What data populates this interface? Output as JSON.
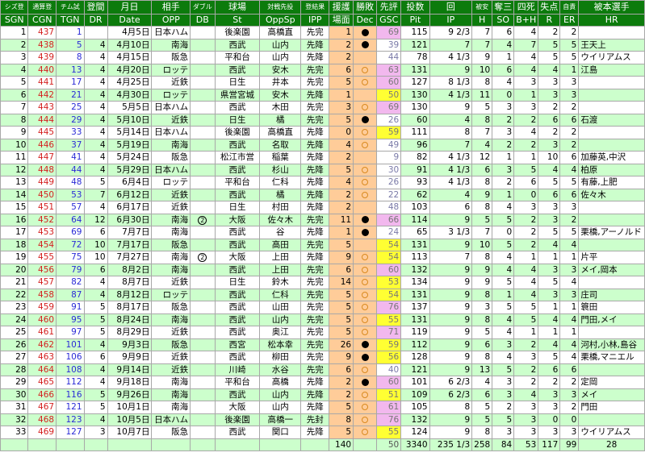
{
  "header_jp": [
    "シズ登",
    "通算登",
    "チム試",
    "登間",
    "月日",
    "相手",
    "ダブル",
    "球場",
    "対戦先投",
    "登結果",
    "援護",
    "勝敗",
    "先評",
    "投数",
    "回",
    "被安",
    "奪三",
    "四死",
    "失点",
    "自責",
    "被本選手"
  ],
  "header_en": [
    "SGN",
    "CGN",
    "TGN",
    "DR",
    "Date",
    "OPP",
    "DB",
    "St",
    "OppSp",
    "IPP",
    "場面",
    "Dec",
    "GSC",
    "Pit",
    "IP",
    "H",
    "SO",
    "B+H",
    "R",
    "ER",
    "HR"
  ],
  "rows": [
    {
      "sgn": "1",
      "cgn": "437",
      "tgn": "1",
      "dr": "",
      "date": "4月5日",
      "opp": "日本ハム",
      "db": "",
      "st": "後楽園",
      "oppsp": "高橋直",
      "ipp": "先完",
      "sc": "1",
      "dec": "W",
      "gsc": "69",
      "pit": "115",
      "ip": "9 2/3",
      "h": "7",
      "so": "6",
      "bh": "4",
      "r": "2",
      "er": "2",
      "hr": ""
    },
    {
      "sgn": "2",
      "cgn": "438",
      "tgn": "5",
      "dr": "4",
      "date": "4月10日",
      "opp": "南海",
      "db": "",
      "st": "西武",
      "oppsp": "山内",
      "ipp": "先降",
      "sc": "2",
      "dec": "W",
      "gsc": "39",
      "pit": "121",
      "ip": "7",
      "h": "7",
      "so": "4",
      "bh": "7",
      "r": "5",
      "er": "5",
      "hr": "王天上"
    },
    {
      "sgn": "3",
      "cgn": "439",
      "tgn": "8",
      "dr": "4",
      "date": "4月15日",
      "opp": "阪急",
      "db": "",
      "st": "平和台",
      "oppsp": "山内",
      "ipp": "先降",
      "sc": "2",
      "dec": "",
      "gsc": "44",
      "pit": "78",
      "ip": "4 1/3",
      "h": "9",
      "so": "1",
      "bh": "4",
      "r": "5",
      "er": "5",
      "hr": "ウイリアムス"
    },
    {
      "sgn": "4",
      "cgn": "440",
      "tgn": "13",
      "dr": "4",
      "date": "4月20日",
      "opp": "ロッテ",
      "db": "",
      "st": "西武",
      "oppsp": "安木",
      "ipp": "先完",
      "sc": "6",
      "dec": "L",
      "gsc": "63",
      "pit": "131",
      "ip": "9",
      "h": "10",
      "so": "6",
      "bh": "4",
      "r": "4",
      "er": "1",
      "hr": "江島"
    },
    {
      "sgn": "5",
      "cgn": "441",
      "tgn": "17",
      "dr": "4",
      "date": "4月25日",
      "opp": "近鉄",
      "db": "",
      "st": "日生",
      "oppsp": "井本",
      "ipp": "先完",
      "sc": "5",
      "dec": "L",
      "gsc": "60",
      "pit": "127",
      "ip": "8 1/3",
      "h": "8",
      "so": "4",
      "bh": "3",
      "r": "3",
      "er": "3",
      "hr": ""
    },
    {
      "sgn": "6",
      "cgn": "442",
      "tgn": "21",
      "dr": "4",
      "date": "4月30日",
      "opp": "ロッテ",
      "db": "",
      "st": "県営宮城",
      "oppsp": "安木",
      "ipp": "先降",
      "sc": "1",
      "dec": "",
      "gsc": "50",
      "pit": "130",
      "ip": "4 1/3",
      "h": "11",
      "so": "0",
      "bh": "1",
      "r": "3",
      "er": "3",
      "hr": ""
    },
    {
      "sgn": "7",
      "cgn": "443",
      "tgn": "25",
      "dr": "4",
      "date": "5月5日",
      "opp": "日本ハム",
      "db": "",
      "st": "西武",
      "oppsp": "木田",
      "ipp": "先完",
      "sc": "3",
      "dec": "L",
      "gsc": "69",
      "pit": "130",
      "ip": "9",
      "h": "5",
      "so": "3",
      "bh": "3",
      "r": "2",
      "er": "2",
      "hr": ""
    },
    {
      "sgn": "8",
      "cgn": "444",
      "tgn": "29",
      "dr": "4",
      "date": "5月10日",
      "opp": "近鉄",
      "db": "",
      "st": "日生",
      "oppsp": "橘",
      "ipp": "先完",
      "sc": "5",
      "dec": "W",
      "gsc": "26",
      "pit": "60",
      "ip": "4",
      "h": "8",
      "so": "2",
      "bh": "2",
      "r": "6",
      "er": "6",
      "hr": "石渡"
    },
    {
      "sgn": "9",
      "cgn": "445",
      "tgn": "33",
      "dr": "4",
      "date": "5月14日",
      "opp": "日本ハム",
      "db": "",
      "st": "後楽園",
      "oppsp": "高橋直",
      "ipp": "先降",
      "sc": "0",
      "dec": "L",
      "gsc": "59",
      "pit": "111",
      "ip": "8",
      "h": "7",
      "so": "3",
      "bh": "4",
      "r": "2",
      "er": "2",
      "hr": ""
    },
    {
      "sgn": "10",
      "cgn": "446",
      "tgn": "37",
      "dr": "4",
      "date": "5月19日",
      "opp": "南海",
      "db": "",
      "st": "西武",
      "oppsp": "名取",
      "ipp": "先降",
      "sc": "4",
      "dec": "L",
      "gsc": "49",
      "pit": "96",
      "ip": "7",
      "h": "4",
      "so": "2",
      "bh": "2",
      "r": "3",
      "er": "2",
      "hr": ""
    },
    {
      "sgn": "11",
      "cgn": "447",
      "tgn": "41",
      "dr": "4",
      "date": "5月24日",
      "opp": "阪急",
      "db": "",
      "st": "松江市営",
      "oppsp": "稲葉",
      "ipp": "先降",
      "sc": "2",
      "dec": "",
      "gsc": "9",
      "pit": "82",
      "ip": "4 1/3",
      "h": "12",
      "so": "1",
      "bh": "1",
      "r": "10",
      "er": "6",
      "hr": "加藤英,中沢"
    },
    {
      "sgn": "12",
      "cgn": "448",
      "tgn": "44",
      "dr": "4",
      "date": "5月29日",
      "opp": "日本ハム",
      "db": "",
      "st": "西武",
      "oppsp": "杉山",
      "ipp": "先降",
      "sc": "5",
      "dec": "L",
      "gsc": "30",
      "pit": "91",
      "ip": "4 1/3",
      "h": "6",
      "so": "3",
      "bh": "5",
      "r": "4",
      "er": "4",
      "hr": "柏原"
    },
    {
      "sgn": "13",
      "cgn": "449",
      "tgn": "48",
      "dr": "5",
      "date": "6月4日",
      "opp": "ロッテ",
      "db": "",
      "st": "平和台",
      "oppsp": "仁科",
      "ipp": "先降",
      "sc": "4",
      "dec": "L",
      "gsc": "26",
      "pit": "93",
      "ip": "4 1/3",
      "h": "8",
      "so": "2",
      "bh": "6",
      "r": "5",
      "er": "5",
      "hr": "有藤,上肥"
    },
    {
      "sgn": "14",
      "cgn": "450",
      "tgn": "53",
      "dr": "7",
      "date": "6月12日",
      "opp": "近鉄",
      "db": "",
      "st": "西武",
      "oppsp": "橘",
      "ipp": "先降",
      "sc": "2",
      "dec": "L",
      "gsc": "22",
      "pit": "62",
      "ip": "4",
      "h": "9",
      "so": "1",
      "bh": "0",
      "r": "6",
      "er": "6",
      "hr": "佐々木"
    },
    {
      "sgn": "15",
      "cgn": "451",
      "tgn": "57",
      "dr": "4",
      "date": "6月17日",
      "opp": "近鉄",
      "db": "",
      "st": "日生",
      "oppsp": "村田",
      "ipp": "先降",
      "sc": "2",
      "dec": "",
      "gsc": "48",
      "pit": "103",
      "ip": "6",
      "h": "8",
      "so": "4",
      "bh": "3",
      "r": "3",
      "er": "3",
      "hr": ""
    },
    {
      "sgn": "16",
      "cgn": "452",
      "tgn": "64",
      "dr": "12",
      "date": "6月30日",
      "opp": "南海",
      "db": "②",
      "st": "大阪",
      "oppsp": "佐々木",
      "ipp": "先完",
      "sc": "11",
      "dec": "W",
      "gsc": "66",
      "pit": "114",
      "ip": "9",
      "h": "5",
      "so": "5",
      "bh": "2",
      "r": "3",
      "er": "2",
      "hr": ""
    },
    {
      "sgn": "17",
      "cgn": "453",
      "tgn": "69",
      "dr": "6",
      "date": "7月7日",
      "opp": "南海",
      "db": "",
      "st": "西武",
      "oppsp": "谷",
      "ipp": "先降",
      "sc": "1",
      "dec": "W",
      "gsc": "24",
      "pit": "65",
      "ip": "3 1/3",
      "h": "7",
      "so": "0",
      "bh": "2",
      "r": "5",
      "er": "5",
      "hr": "栗橋,アーノルド"
    },
    {
      "sgn": "18",
      "cgn": "454",
      "tgn": "72",
      "dr": "10",
      "date": "7月17日",
      "opp": "阪急",
      "db": "",
      "st": "西武",
      "oppsp": "高田",
      "ipp": "先完",
      "sc": "5",
      "dec": "",
      "gsc": "54",
      "pit": "131",
      "ip": "9",
      "h": "10",
      "so": "5",
      "bh": "2",
      "r": "4",
      "er": "4",
      "hr": ""
    },
    {
      "sgn": "19",
      "cgn": "455",
      "tgn": "75",
      "dr": "10",
      "date": "7月27日",
      "opp": "南海",
      "db": "②",
      "st": "大阪",
      "oppsp": "上田",
      "ipp": "先降",
      "sc": "9",
      "dec": "L",
      "gsc": "54",
      "pit": "113",
      "ip": "7",
      "h": "8",
      "so": "4",
      "bh": "1",
      "r": "1",
      "er": "1",
      "hr": "片平"
    },
    {
      "sgn": "20",
      "cgn": "456",
      "tgn": "79",
      "dr": "6",
      "date": "8月2日",
      "opp": "南海",
      "db": "",
      "st": "西武",
      "oppsp": "上田",
      "ipp": "先完",
      "sc": "6",
      "dec": "L",
      "gsc": "60",
      "pit": "132",
      "ip": "9",
      "h": "9",
      "so": "4",
      "bh": "4",
      "r": "3",
      "er": "3",
      "hr": "メイ,岡本"
    },
    {
      "sgn": "21",
      "cgn": "457",
      "tgn": "82",
      "dr": "4",
      "date": "8月7日",
      "opp": "近鉄",
      "db": "",
      "st": "日生",
      "oppsp": "鈴木",
      "ipp": "先完",
      "sc": "14",
      "dec": "L",
      "gsc": "53",
      "pit": "134",
      "ip": "9",
      "h": "9",
      "so": "5",
      "bh": "4",
      "r": "5",
      "er": "4",
      "hr": ""
    },
    {
      "sgn": "22",
      "cgn": "458",
      "tgn": "87",
      "dr": "4",
      "date": "8月12日",
      "opp": "ロッテ",
      "db": "",
      "st": "西武",
      "oppsp": "仁科",
      "ipp": "先完",
      "sc": "5",
      "dec": "L",
      "gsc": "54",
      "pit": "131",
      "ip": "9",
      "h": "8",
      "so": "1",
      "bh": "4",
      "r": "3",
      "er": "3",
      "hr": "庄司"
    },
    {
      "sgn": "23",
      "cgn": "459",
      "tgn": "91",
      "dr": "5",
      "date": "8月17日",
      "opp": "阪急",
      "db": "",
      "st": "西武",
      "oppsp": "山田",
      "ipp": "先完",
      "sc": "5",
      "dec": "L",
      "gsc": "76",
      "pit": "137",
      "ip": "9",
      "h": "3",
      "so": "5",
      "bh": "5",
      "r": "1",
      "er": "1",
      "hr": "簑田"
    },
    {
      "sgn": "24",
      "cgn": "460",
      "tgn": "95",
      "dr": "5",
      "date": "8月24日",
      "opp": "南海",
      "db": "",
      "st": "西武",
      "oppsp": "山内",
      "ipp": "先完",
      "sc": "5",
      "dec": "L",
      "gsc": "55",
      "pit": "131",
      "ip": "9",
      "h": "8",
      "so": "4",
      "bh": "5",
      "r": "4",
      "er": "4",
      "hr": "門田,メイ"
    },
    {
      "sgn": "25",
      "cgn": "461",
      "tgn": "97",
      "dr": "5",
      "date": "8月29日",
      "opp": "近鉄",
      "db": "",
      "st": "西武",
      "oppsp": "奥江",
      "ipp": "先完",
      "sc": "5",
      "dec": "L",
      "gsc": "71",
      "pit": "119",
      "ip": "9",
      "h": "5",
      "so": "4",
      "bh": "1",
      "r": "1",
      "er": "1",
      "hr": ""
    },
    {
      "sgn": "26",
      "cgn": "462",
      "tgn": "101",
      "dr": "4",
      "date": "9月3日",
      "opp": "阪急",
      "db": "",
      "st": "西宮",
      "oppsp": "松本幸",
      "ipp": "先完",
      "sc": "26",
      "dec": "W",
      "gsc": "59",
      "pit": "112",
      "ip": "9",
      "h": "6",
      "so": "3",
      "bh": "2",
      "r": "4",
      "er": "4",
      "hr": "河村,小林,島谷"
    },
    {
      "sgn": "27",
      "cgn": "463",
      "tgn": "106",
      "dr": "6",
      "date": "9月9日",
      "opp": "近鉄",
      "db": "",
      "st": "西武",
      "oppsp": "柳田",
      "ipp": "先完",
      "sc": "9",
      "dec": "W",
      "gsc": "56",
      "pit": "128",
      "ip": "9",
      "h": "8",
      "so": "4",
      "bh": "3",
      "r": "5",
      "er": "4",
      "hr": "栗橋,マニエル"
    },
    {
      "sgn": "28",
      "cgn": "464",
      "tgn": "108",
      "dr": "4",
      "date": "9月14日",
      "opp": "近鉄",
      "db": "",
      "st": "川崎",
      "oppsp": "水谷",
      "ipp": "先完",
      "sc": "6",
      "dec": "L",
      "gsc": "40",
      "pit": "121",
      "ip": "9",
      "h": "13",
      "so": "5",
      "bh": "2",
      "r": "6",
      "er": "6",
      "hr": ""
    },
    {
      "sgn": "29",
      "cgn": "465",
      "tgn": "112",
      "dr": "4",
      "date": "9月18日",
      "opp": "南海",
      "db": "",
      "st": "平和台",
      "oppsp": "高橋",
      "ipp": "先降",
      "sc": "2",
      "dec": "W",
      "gsc": "60",
      "pit": "101",
      "ip": "6 2/3",
      "h": "4",
      "so": "3",
      "bh": "2",
      "r": "2",
      "er": "2",
      "hr": "定岡"
    },
    {
      "sgn": "30",
      "cgn": "466",
      "tgn": "116",
      "dr": "5",
      "date": "9月26日",
      "opp": "南海",
      "db": "",
      "st": "西武",
      "oppsp": "山内",
      "ipp": "先降",
      "sc": "2",
      "dec": "L",
      "gsc": "51",
      "pit": "109",
      "ip": "6 2/3",
      "h": "6",
      "so": "3",
      "bh": "4",
      "r": "3",
      "er": "3",
      "hr": "メイ"
    },
    {
      "sgn": "31",
      "cgn": "467",
      "tgn": "121",
      "dr": "5",
      "date": "10月1日",
      "opp": "南海",
      "db": "",
      "st": "大阪",
      "oppsp": "山内",
      "ipp": "先降",
      "sc": "5",
      "dec": "L",
      "gsc": "61",
      "pit": "105",
      "ip": "8",
      "h": "5",
      "so": "2",
      "bh": "3",
      "r": "3",
      "er": "2",
      "hr": "門田"
    },
    {
      "sgn": "32",
      "cgn": "468",
      "tgn": "123",
      "dr": "4",
      "date": "10月5日",
      "opp": "日本ハム",
      "db": "",
      "st": "後楽園",
      "oppsp": "高橋一",
      "ipp": "先封",
      "sc": "8",
      "dec": "L",
      "gsc": "76",
      "pit": "132",
      "ip": "9",
      "h": "5",
      "so": "5",
      "bh": "3",
      "r": "0",
      "er": "0",
      "hr": ""
    },
    {
      "sgn": "33",
      "cgn": "469",
      "tgn": "127",
      "dr": "3",
      "date": "10月7日",
      "opp": "阪急",
      "db": "",
      "st": "西武",
      "oppsp": "関口",
      "ipp": "先降",
      "sc": "5",
      "dec": "L",
      "gsc": "55",
      "pit": "124",
      "ip": "9",
      "h": "8",
      "so": "3",
      "bh": "3",
      "r": "3",
      "er": "3",
      "hr": "ウイリアムス"
    }
  ],
  "totals": {
    "sc": "140",
    "gsc": "50",
    "pit": "3340",
    "ip": "235 1/3",
    "h": "258",
    "so": "84",
    "bh": "53",
    "r": "117",
    "er": "99",
    "hr": "28"
  },
  "colors": {
    "header_bg": "#0c7b0c",
    "row_alt": "#ccffcc",
    "pitch_col": "#ffcc99",
    "gsc_high": "#f2b8ee",
    "gsc_mid": "#ffff33",
    "cgn_text": "#d42020",
    "tgn_text": "#2a2ad6"
  },
  "icons": {
    "win": "filled-circle-icon",
    "loss": "hollow-circle-icon",
    "double": "circled-2-icon"
  }
}
